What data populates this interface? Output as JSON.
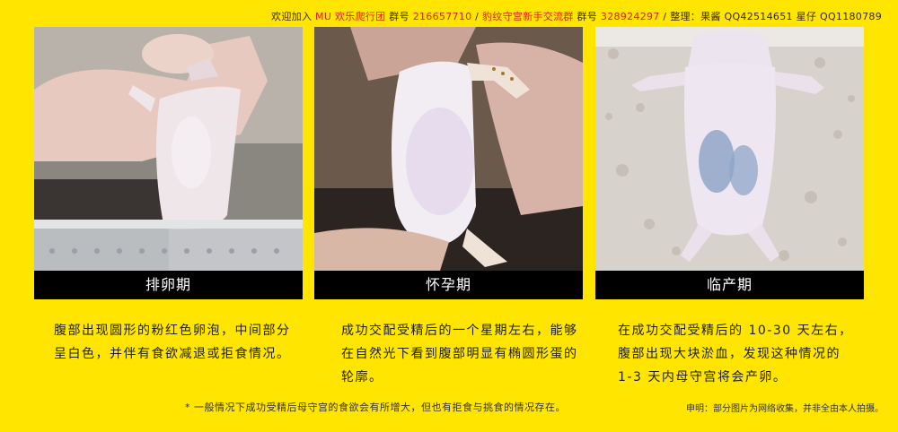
{
  "header": {
    "p1": "欢迎加入 ",
    "club": "MU 欢乐爬行团",
    "p2": " 群号 ",
    "group1": "216657710",
    "p3": " / ",
    "group2_label": "豹纹守宫新手交流群",
    "p4": "  群号 ",
    "group2": "328924297",
    "p5": " / 整理：果酱 QQ42514651   星仔 QQ1180789"
  },
  "panels": [
    {
      "caption": "排卵期",
      "desc": "腹部出现圆形的粉红色卵泡，中间部分呈白色，并伴有食欲减退或拒食情况。"
    },
    {
      "caption": "怀孕期",
      "desc": "成功交配受精后的一个星期左右，能够在自然光下看到腹部明显有椭圆形蛋的轮廓。"
    },
    {
      "caption": "临产期",
      "desc": "在成功交配受精后的 10-30 天左右，腹部出现大块淤血，发现这种情况的 1-3 天内母守宫将会产卵。"
    }
  ],
  "footer": {
    "note": "* 一般情况下成功受精后母守宫的食欲会有所增大，但也有拒食与挑食的情况存在。",
    "disclaimer": "申明：部分图片为网络收集，并非全由本人拍摄。"
  },
  "colors": {
    "background": "#FFE500",
    "accent": "#e0201c",
    "caption_bar": "#000000"
  }
}
